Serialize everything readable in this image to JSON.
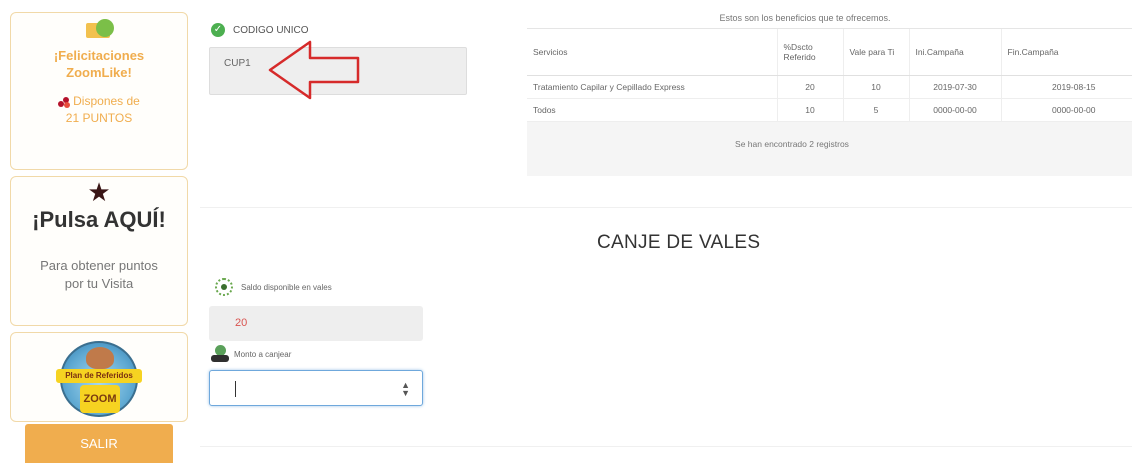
{
  "sidebar": {
    "congrats_title_line1": "¡Felicitaciones",
    "congrats_title_line2": "ZoomLike!",
    "points_line1": "Dispones de",
    "points_line2": "21 PUNTOS",
    "pulsa_title": "¡Pulsa AQUÍ!",
    "pulsa_text_line1": "Para obtener puntos",
    "pulsa_text_line2": "por tu Visita",
    "logo_ribbon": "Plan de Referidos",
    "logo_text": "ZOOM",
    "salir_label": "SALIR"
  },
  "code": {
    "label": "CODIGO UNICO",
    "value": "CUP1"
  },
  "benefits": {
    "caption": "Estos son los beneficios que te ofrecemos.",
    "headers": [
      "Servicios",
      "%Dscto Referido",
      "Vale para Ti",
      "Ini.Campaña",
      "Fin.Campaña"
    ],
    "rows": [
      [
        "Tratamiento Capilar y Cepillado Express",
        "20",
        "10",
        "2019-07-30",
        "2019-08-15"
      ],
      [
        "Todos",
        "10",
        "5",
        "0000-00-00",
        "0000-00-00"
      ]
    ],
    "footer": "Se han encontrado 2 registros"
  },
  "canje": {
    "title": "CANJE DE VALES",
    "saldo_label": "Saldo disponible en vales",
    "saldo_value": "20",
    "monto_label": "Monto a canjear",
    "monto_value": ""
  },
  "colors": {
    "accent_orange": "#f0ad4e",
    "input_focus": "#6fa8dc",
    "saldo_red": "#d9534f",
    "arrow_red": "#d62a2a"
  }
}
